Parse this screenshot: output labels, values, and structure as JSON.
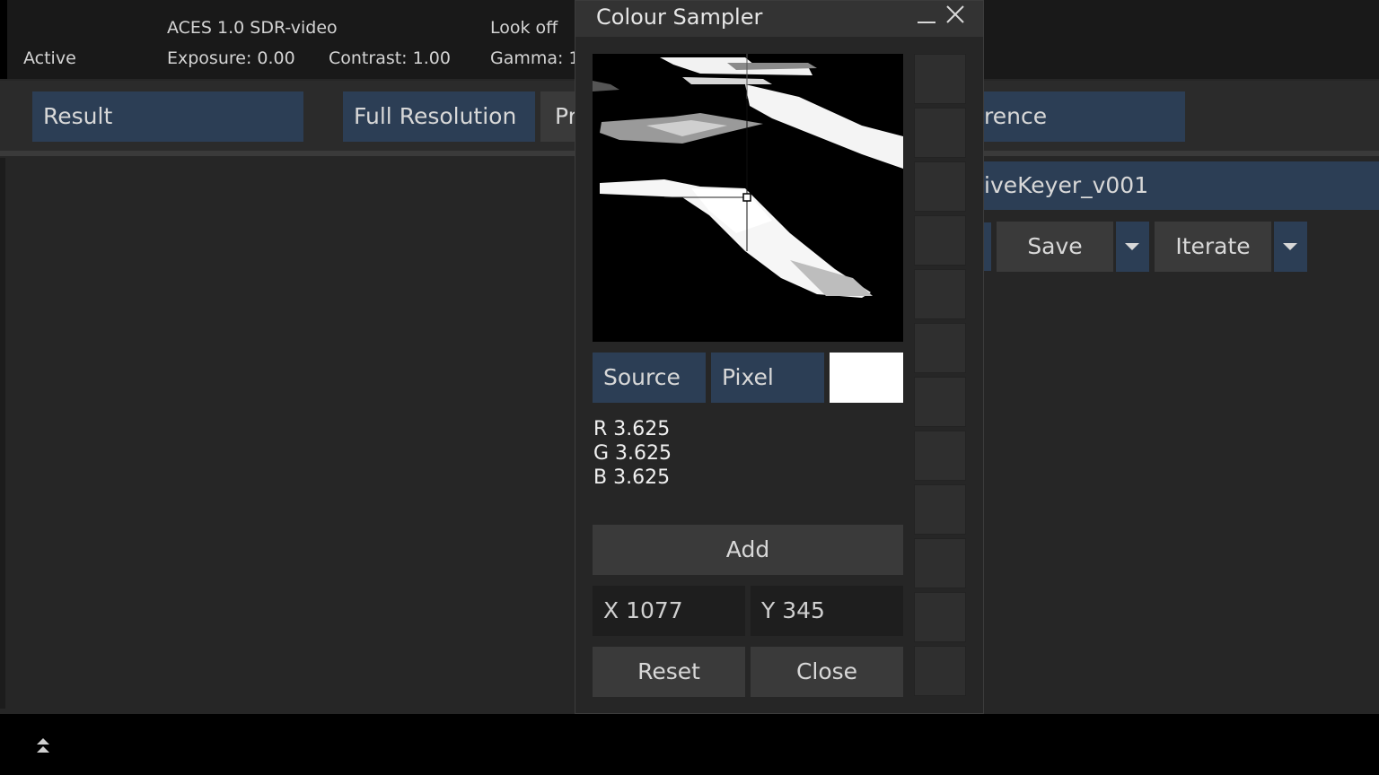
{
  "status": {
    "state": "Active",
    "colorspace": "ACES 1.0 SDR-video",
    "exposure": "Exposure: 0.00",
    "contrast": "Contrast: 1.00",
    "look": "Look off",
    "gamma": "Gamma: 1."
  },
  "toolbar": {
    "result": "Result",
    "resolution": "Full Resolution",
    "proxy_partial": "Pr",
    "reference_partial": "rence"
  },
  "clip": {
    "name_partial": "iveKeyer_v001",
    "save": "Save",
    "iterate": "Iterate"
  },
  "dialog": {
    "title": "Colour Sampler",
    "source_label": "Source",
    "pixel_label": "Pixel",
    "sample_color": "#ffffff",
    "r": "R 3.625",
    "g": "G 3.625",
    "b": "B 3.625",
    "add": "Add",
    "x": "X 1077",
    "y": "Y 345",
    "reset": "Reset",
    "close": "Close",
    "swatch_count": 12
  },
  "colors": {
    "accent": "#2c3e55",
    "button": "#3a3a3a"
  }
}
